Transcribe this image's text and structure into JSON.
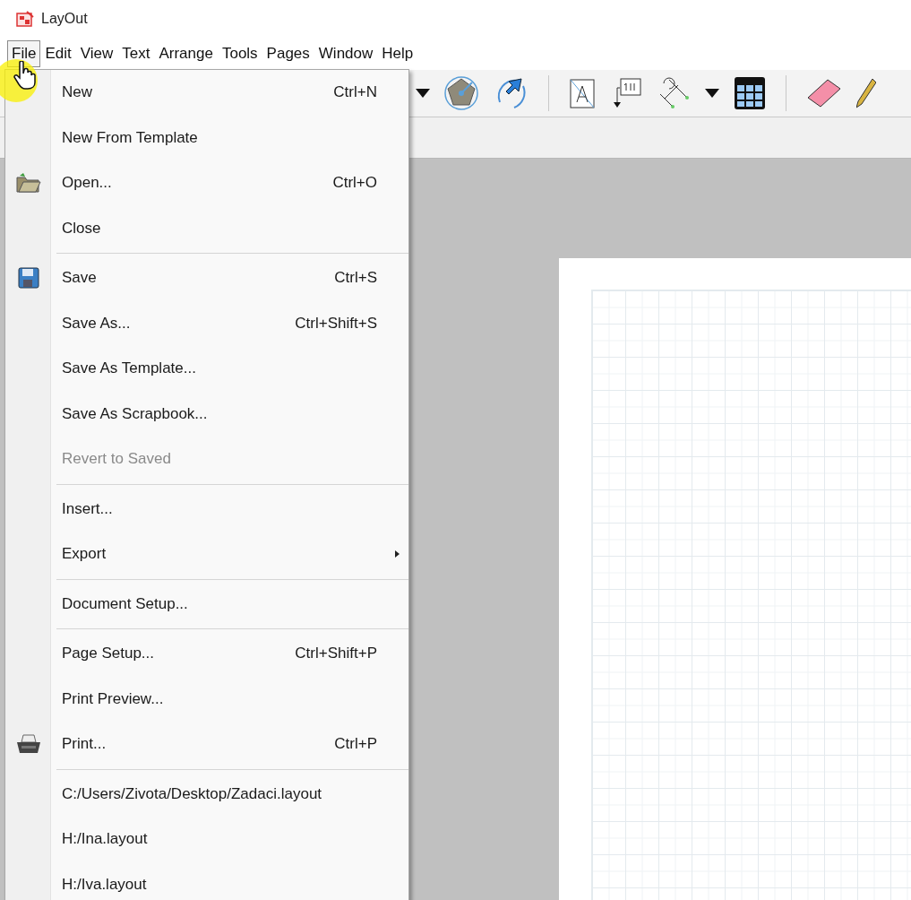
{
  "window": {
    "title": "LayOut"
  },
  "menu_bar": [
    {
      "label": "File",
      "selected": true
    },
    {
      "label": "Edit",
      "selected": false
    },
    {
      "label": "View",
      "selected": false
    },
    {
      "label": "Text",
      "selected": false
    },
    {
      "label": "Arrange",
      "selected": false
    },
    {
      "label": "Tools",
      "selected": false
    },
    {
      "label": "Pages",
      "selected": false
    },
    {
      "label": "Window",
      "selected": false
    },
    {
      "label": "Help",
      "selected": false
    }
  ],
  "file_menu": {
    "items": [
      {
        "kind": "item",
        "label": "New",
        "shortcut": "Ctrl+N",
        "disabled": false,
        "submenu": false
      },
      {
        "kind": "item",
        "label": "New From Template",
        "disabled": false,
        "submenu": false
      },
      {
        "kind": "item",
        "label": "Open...",
        "shortcut": "Ctrl+O",
        "disabled": false,
        "submenu": false
      },
      {
        "kind": "item",
        "label": "Close",
        "disabled": false,
        "submenu": false
      },
      {
        "kind": "separator"
      },
      {
        "kind": "item",
        "label": "Save",
        "shortcut": "Ctrl+S",
        "disabled": false,
        "submenu": false
      },
      {
        "kind": "item",
        "label": "Save As...",
        "shortcut": "Ctrl+Shift+S",
        "disabled": false,
        "submenu": false
      },
      {
        "kind": "item",
        "label": "Save As Template...",
        "disabled": false,
        "submenu": false
      },
      {
        "kind": "item",
        "label": "Save As Scrapbook...",
        "disabled": false,
        "submenu": false
      },
      {
        "kind": "item",
        "label": "Revert to Saved",
        "disabled": true,
        "submenu": false
      },
      {
        "kind": "separator"
      },
      {
        "kind": "item",
        "label": "Insert...",
        "disabled": false,
        "submenu": false
      },
      {
        "kind": "item",
        "label": "Export",
        "disabled": false,
        "submenu": true
      },
      {
        "kind": "separator"
      },
      {
        "kind": "item",
        "label": "Document Setup...",
        "disabled": false,
        "submenu": false
      },
      {
        "kind": "separator"
      },
      {
        "kind": "item",
        "label": "Page Setup...",
        "shortcut": "Ctrl+Shift+P",
        "disabled": false,
        "submenu": false
      },
      {
        "kind": "item",
        "label": "Print Preview...",
        "disabled": false,
        "submenu": false
      },
      {
        "kind": "item",
        "label": "Print...",
        "shortcut": "Ctrl+P",
        "disabled": false,
        "submenu": false
      },
      {
        "kind": "separator"
      },
      {
        "kind": "item",
        "label": "C:/Users/Zivota/Desktop/Zadaci.layout",
        "disabled": false,
        "submenu": false
      },
      {
        "kind": "item",
        "label": "H:/Ina.layout",
        "disabled": false,
        "submenu": false
      },
      {
        "kind": "item",
        "label": "H:/Iva.layout",
        "disabled": false,
        "submenu": false
      }
    ]
  }
}
